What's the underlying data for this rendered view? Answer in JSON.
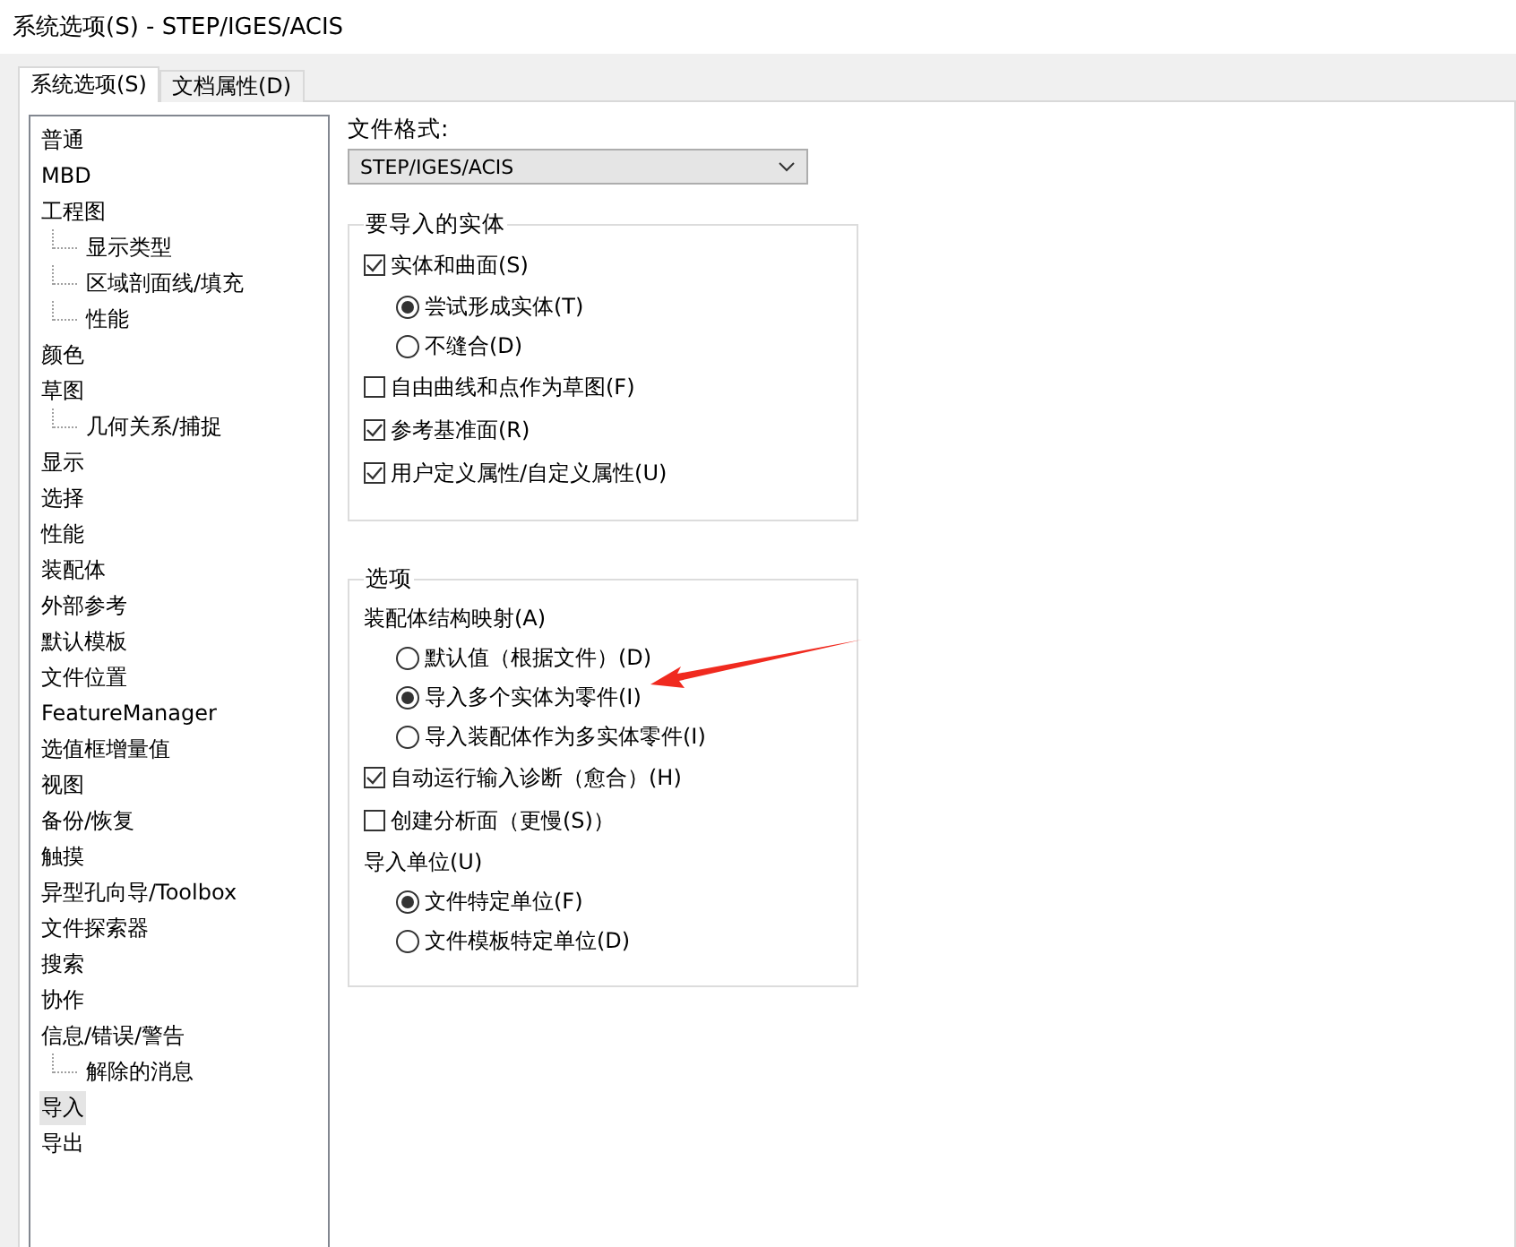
{
  "window": {
    "title": "系统选项(S) - STEP/IGES/ACIS"
  },
  "tabs": [
    {
      "label": "系统选项(S)",
      "selected": true
    },
    {
      "label": "文档属性(D)",
      "selected": false
    }
  ],
  "sidebar": {
    "items": [
      {
        "label": "普通",
        "selected": false
      },
      {
        "label": "MBD",
        "selected": false
      },
      {
        "label": "工程图",
        "selected": false,
        "children": [
          {
            "label": "显示类型",
            "selected": false
          },
          {
            "label": "区域剖面线/填充",
            "selected": false
          },
          {
            "label": "性能",
            "selected": false
          }
        ]
      },
      {
        "label": "颜色",
        "selected": false
      },
      {
        "label": "草图",
        "selected": false,
        "children": [
          {
            "label": "几何关系/捕捉",
            "selected": false
          }
        ]
      },
      {
        "label": "显示",
        "selected": false
      },
      {
        "label": "选择",
        "selected": false
      },
      {
        "label": "性能",
        "selected": false
      },
      {
        "label": "装配体",
        "selected": false
      },
      {
        "label": "外部参考",
        "selected": false
      },
      {
        "label": "默认模板",
        "selected": false
      },
      {
        "label": "文件位置",
        "selected": false
      },
      {
        "label": "FeatureManager",
        "selected": false
      },
      {
        "label": "选值框增量值",
        "selected": false
      },
      {
        "label": "视图",
        "selected": false
      },
      {
        "label": "备份/恢复",
        "selected": false
      },
      {
        "label": "触摸",
        "selected": false
      },
      {
        "label": "异型孔向导/Toolbox",
        "selected": false
      },
      {
        "label": "文件探索器",
        "selected": false
      },
      {
        "label": "搜索",
        "selected": false
      },
      {
        "label": "协作",
        "selected": false
      },
      {
        "label": "信息/错误/警告",
        "selected": false,
        "children": [
          {
            "label": "解除的消息",
            "selected": false
          }
        ]
      },
      {
        "label": "导入",
        "selected": true
      },
      {
        "label": "导出",
        "selected": false
      }
    ]
  },
  "file_format": {
    "label": "文件格式:",
    "value": "STEP/IGES/ACIS"
  },
  "groups": [
    {
      "title": "要导入的实体",
      "items": [
        {
          "kind": "checkbox",
          "label": "实体和曲面(S)",
          "checked": true
        },
        {
          "kind": "radio",
          "label": "尝试形成实体(T)",
          "selected": true
        },
        {
          "kind": "radio",
          "label": "不缝合(D)",
          "selected": false
        },
        {
          "kind": "checkbox",
          "label": "自由曲线和点作为草图(F)",
          "checked": false
        },
        {
          "kind": "checkbox",
          "label": "参考基准面(R)",
          "checked": true
        },
        {
          "kind": "checkbox",
          "label": "用户定义属性/自定义属性(U)",
          "checked": true
        }
      ]
    },
    {
      "title": "选项",
      "items": [
        {
          "kind": "label",
          "label": "装配体结构映射(A)"
        },
        {
          "kind": "radio",
          "label": "默认值（根据文件）(D)",
          "selected": false
        },
        {
          "kind": "radio",
          "label": "导入多个实体为零件(I)",
          "selected": true
        },
        {
          "kind": "radio",
          "label": "导入装配体作为多实体零件(I)",
          "selected": false
        },
        {
          "kind": "checkbox",
          "label": "自动运行输入诊断（愈合）(H)",
          "checked": true
        },
        {
          "kind": "checkbox",
          "label": "创建分析面（更慢(S)）",
          "checked": false
        },
        {
          "kind": "label",
          "label": "导入单位(U)"
        },
        {
          "kind": "radio",
          "label": "文件特定单位(F)",
          "selected": true
        },
        {
          "kind": "radio",
          "label": "文件模板特定单位(D)",
          "selected": false
        }
      ]
    }
  ]
}
